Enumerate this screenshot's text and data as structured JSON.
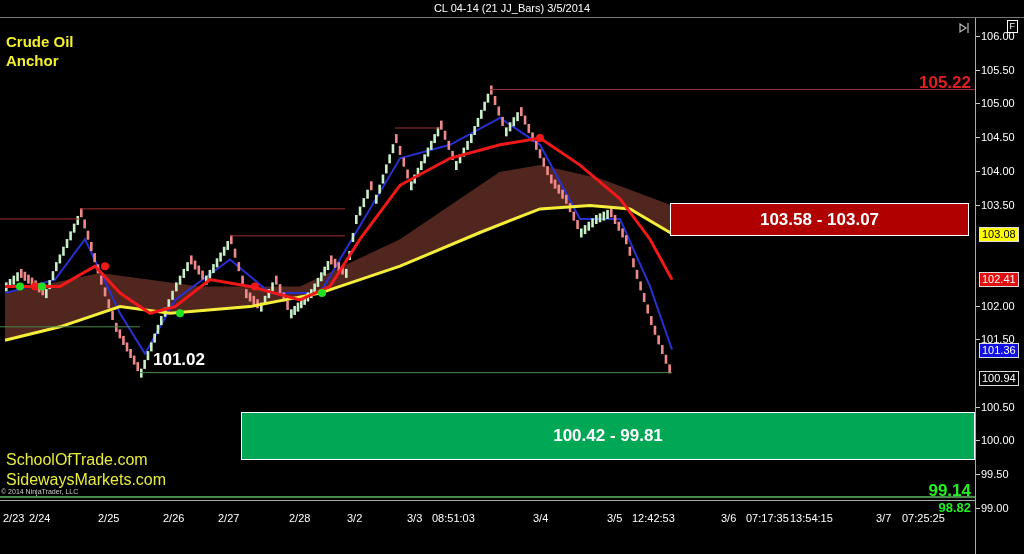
{
  "window": {
    "title": "CL 04-14 (21 JJ_Bars)  3/5/2014"
  },
  "chart": {
    "labels": [
      "Crude Oil",
      "Anchor"
    ],
    "notes": [
      "SchoolOfTrade.com",
      "SidewaysMarkets.com"
    ],
    "copyright": "© 2014 NinjaTrader, LLC",
    "axis_button": "F",
    "zones": [
      {
        "label": "103.58 - 103.07",
        "kind": "resistance"
      },
      {
        "label": "100.42 - 99.81",
        "kind": "support"
      }
    ],
    "price_texts": [
      {
        "text": "105.22",
        "color": "#e02020"
      },
      {
        "text": "101.02",
        "color": "#ffffff"
      },
      {
        "text": "99.14",
        "color": "#22ee22"
      },
      {
        "text": "98.82",
        "color": "#22ee22"
      }
    ],
    "price_markers": [
      {
        "text": "103.08",
        "color": "#ffff00"
      },
      {
        "text": "102.41",
        "color": "#e01010"
      },
      {
        "text": "101.36",
        "color": "#1010e0"
      },
      {
        "text": "100.94",
        "color": "#000000"
      }
    ],
    "y_axis": [
      "106.00",
      "105.50",
      "105.00",
      "104.50",
      "104.00",
      "103.50",
      "102.00",
      "101.50",
      "100.50",
      "100.00",
      "99.50",
      "99.00"
    ],
    "x_axis": [
      "2/23",
      "2/24",
      "2/25",
      "2/26",
      "2/27",
      "2/28",
      "3/2",
      "3/3",
      "08:51:03",
      "3/4",
      "3/5",
      "12:42:53",
      "3/6",
      "07:17:35",
      "13:54:15",
      "3/7",
      "07:25:25"
    ]
  }
}
